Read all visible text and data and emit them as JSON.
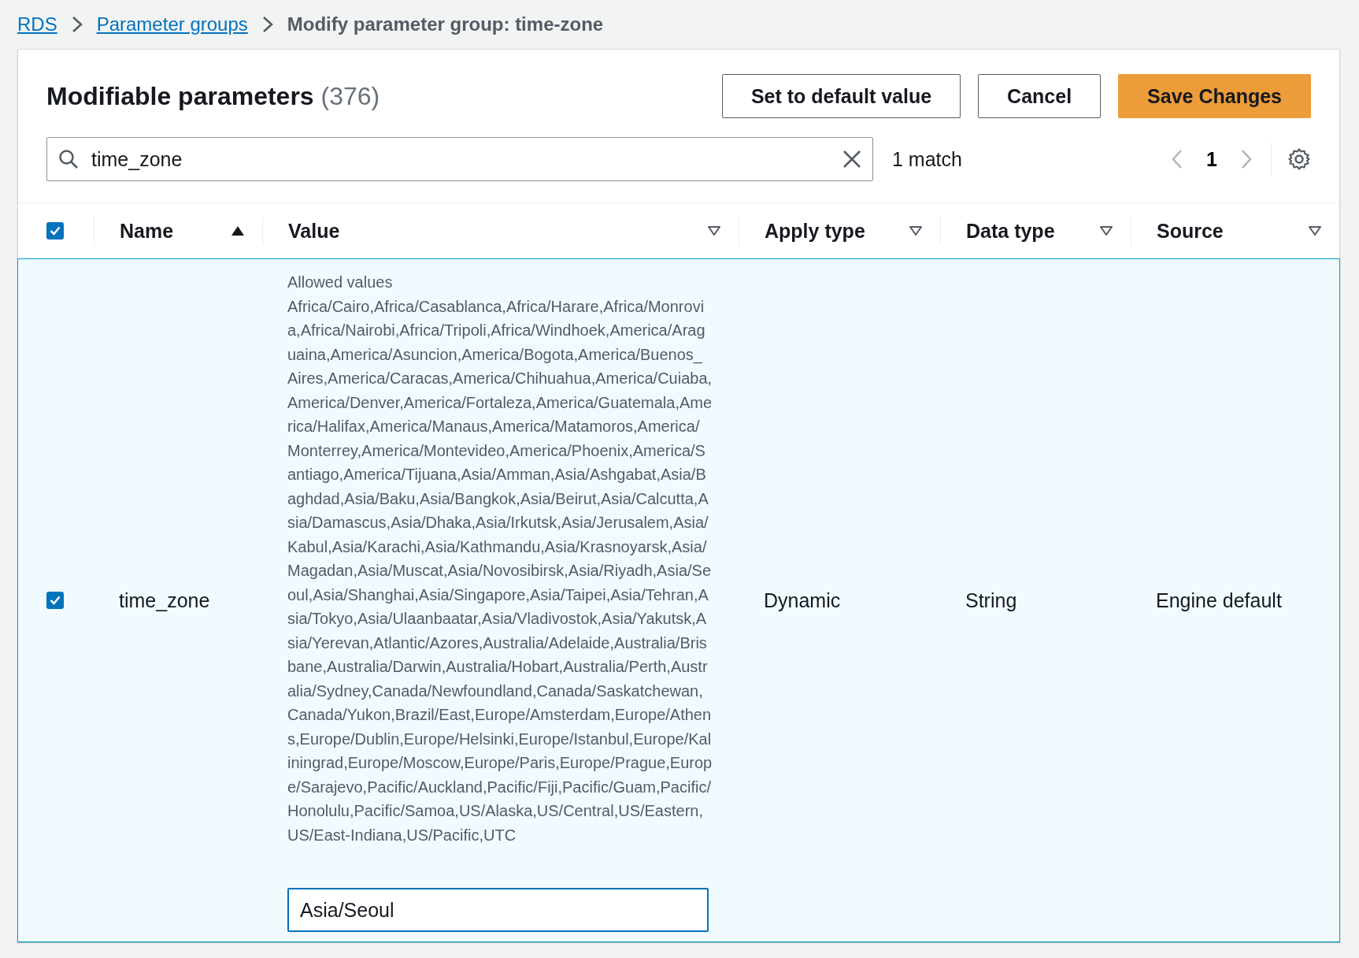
{
  "breadcrumbs": [
    {
      "label": "RDS",
      "kind": "link"
    },
    {
      "label": "Parameter groups",
      "kind": "link"
    },
    {
      "label": "Modify parameter group: time-zone",
      "kind": "current"
    }
  ],
  "panel": {
    "title": "Modifiable parameters",
    "count": "(376)",
    "buttons": [
      {
        "label": "Set to default value",
        "kind": "normal"
      },
      {
        "label": "Cancel",
        "kind": "normal"
      },
      {
        "label": "Save Changes",
        "kind": "primary"
      }
    ],
    "search": {
      "value": "time_zone"
    },
    "match_count": "1 match",
    "pagination": {
      "page": "1",
      "previous_disabled": true,
      "next_disabled": true
    }
  },
  "table": {
    "select_all": {
      "checked": true
    },
    "columns": [
      {
        "label": "Name",
        "sorted": true
      },
      {
        "label": "Value",
        "sorted": false
      },
      {
        "label": "Apply type",
        "sorted": false
      },
      {
        "label": "Data type",
        "sorted": false
      },
      {
        "label": "Source",
        "sorted": false
      }
    ],
    "rows": [
      {
        "selected": true,
        "checked": true,
        "name": "time_zone",
        "allowed_label": "Allowed values",
        "allowed_values": "Africa/Cairo,Africa/Casablanca,Africa/Harare,Africa/Monrovia,Africa/Nairobi,Africa/Tripoli,Africa/Windhoek,America/Araguaina,America/Asuncion,America/Bogota,America/Buenos_Aires,America/Caracas,America/Chihuahua,America/Cuiaba,America/Denver,America/Fortaleza,America/Guatemala,America/Halifax,America/Manaus,America/Matamoros,America/Monterrey,America/Montevideo,America/Phoenix,America/Santiago,America/Tijuana,Asia/Amman,Asia/Ashgabat,Asia/Baghdad,Asia/Baku,Asia/Bangkok,Asia/Beirut,Asia/Calcutta,Asia/Damascus,Asia/Dhaka,Asia/Irkutsk,Asia/Jerusalem,Asia/Kabul,Asia/Karachi,Asia/Kathmandu,Asia/Krasnoyarsk,Asia/Magadan,Asia/Muscat,Asia/Novosibirsk,Asia/Riyadh,Asia/Seoul,Asia/Shanghai,Asia/Singapore,Asia/Taipei,Asia/Tehran,Asia/Tokyo,Asia/Ulaanbaatar,Asia/Vladivostok,Asia/Yakutsk,Asia/Yerevan,Atlantic/Azores,Australia/Adelaide,Australia/Brisbane,Australia/Darwin,Australia/Hobart,Australia/Perth,Australia/Sydney,Canada/Newfoundland,Canada/Saskatchewan,Canada/Yukon,Brazil/East,Europe/Amsterdam,Europe/Athens,Europe/Dublin,Europe/Helsinki,Europe/Istanbul,Europe/Kaliningrad,Europe/Moscow,Europe/Paris,Europe/Prague,Europe/Sarajevo,Pacific/Auckland,Pacific/Fiji,Pacific/Guam,Pacific/Honolulu,Pacific/Samoa,US/Alaska,US/Central,US/Eastern,US/East-Indiana,US/Pacific,UTC",
        "value": "Asia/Seoul",
        "apply_type": "Dynamic",
        "data_type": "String",
        "source": "Engine default"
      }
    ]
  }
}
